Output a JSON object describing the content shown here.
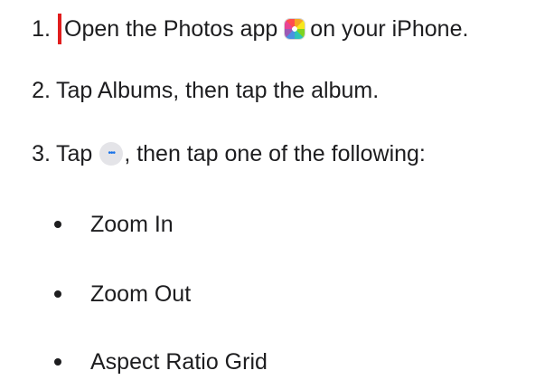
{
  "steps": [
    {
      "number": "1.",
      "parts": {
        "before_icon": "Open the Photos app",
        "after_icon": "on your iPhone."
      },
      "icon": "photos-app-icon"
    },
    {
      "number": "2.",
      "text": "Tap Albums, then tap the album."
    },
    {
      "number": "3.",
      "parts": {
        "before_icon": "Tap",
        "after_icon": ", then tap one of the following:"
      },
      "icon": "more-icon"
    }
  ],
  "options": [
    {
      "label": "Zoom In"
    },
    {
      "label": "Zoom Out"
    },
    {
      "label": "Aspect Ratio Grid"
    }
  ],
  "colors": {
    "text": "#1d1d1f",
    "cursor_mark": "#e11d1d",
    "more_icon_bg": "#e4e4e8",
    "more_icon_dots": "#1a73e8"
  }
}
